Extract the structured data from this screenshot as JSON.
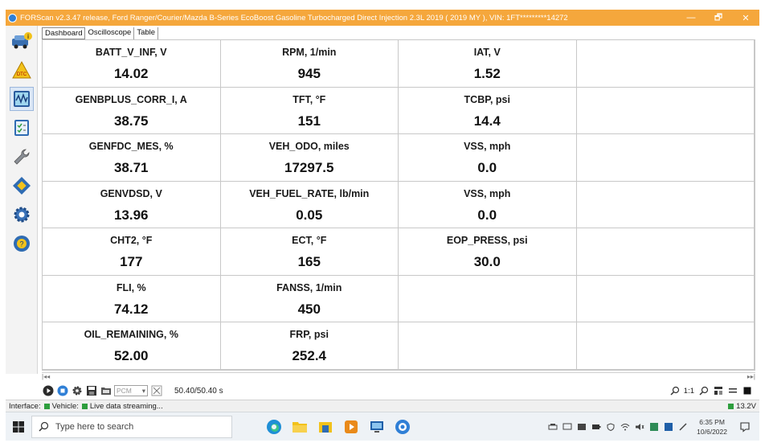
{
  "window": {
    "title": "FORScan v2.3.47 release, Ford Ranger/Courier/Mazda B-Series EcoBoost Gasoline Turbocharged Direct Injection 2.3L 2019 ( 2019 MY ), VIN: 1FT*********14272",
    "minimize": "—",
    "maximize": "🗗",
    "close": "✕"
  },
  "sidebar": {
    "items": [
      {
        "icon": "vehicle-info-icon"
      },
      {
        "icon": "dtc-icon"
      },
      {
        "icon": "oscilloscope-icon",
        "active": true
      },
      {
        "icon": "checklist-icon"
      },
      {
        "icon": "wrench-icon"
      },
      {
        "icon": "chip-icon"
      },
      {
        "icon": "gear-icon"
      },
      {
        "icon": "help-icon"
      }
    ]
  },
  "tabs": [
    {
      "label": "Dashboard",
      "active": true
    },
    {
      "label": "Oscilloscope"
    },
    {
      "label": "Table"
    }
  ],
  "dashboard": {
    "cells": [
      {
        "label": "BATT_V_INF, V",
        "value": "14.02"
      },
      {
        "label": "RPM, 1/min",
        "value": "945"
      },
      {
        "label": "IAT, V",
        "value": "1.52"
      },
      {
        "label": "",
        "value": ""
      },
      {
        "label": "GENBPLUS_CORR_I, A",
        "value": "38.75"
      },
      {
        "label": "TFT, °F",
        "value": "151"
      },
      {
        "label": "TCBP, psi",
        "value": "14.4"
      },
      {
        "label": "",
        "value": ""
      },
      {
        "label": "GENFDC_MES, %",
        "value": "38.71"
      },
      {
        "label": "VEH_ODO, miles",
        "value": "17297.5"
      },
      {
        "label": "VSS, mph",
        "value": "0.0"
      },
      {
        "label": "",
        "value": ""
      },
      {
        "label": "GENVDSD, V",
        "value": "13.96"
      },
      {
        "label": "VEH_FUEL_RATE, lb/min",
        "value": "0.05"
      },
      {
        "label": "VSS, mph",
        "value": "0.0"
      },
      {
        "label": "",
        "value": ""
      },
      {
        "label": "CHT2, °F",
        "value": "177"
      },
      {
        "label": "ECT, °F",
        "value": "165"
      },
      {
        "label": "EOP_PRESS, psi",
        "value": "30.0"
      },
      {
        "label": "",
        "value": ""
      },
      {
        "label": "FLI, %",
        "value": "74.12"
      },
      {
        "label": "FANSS, 1/min",
        "value": "450"
      },
      {
        "label": "",
        "value": ""
      },
      {
        "label": "",
        "value": ""
      },
      {
        "label": "OIL_REMAINING, %",
        "value": "52.00"
      },
      {
        "label": "FRP, psi",
        "value": "252.4"
      },
      {
        "label": "",
        "value": ""
      },
      {
        "label": "",
        "value": ""
      }
    ]
  },
  "scroll": {
    "left": "|◂◂",
    "right": "▸▸|"
  },
  "toolbar": {
    "module_select": "PCM",
    "time": "50.40/50.40 s",
    "zoom": "1:1"
  },
  "status": {
    "interface_label": "Interface:",
    "vehicle_label": "Vehicle:",
    "message": "Live data streaming...",
    "voltage": "13.2V",
    "indicator_color": "#2e9e3e"
  },
  "taskbar": {
    "search_placeholder": "Type here to search",
    "time": "6:35 PM",
    "date": "10/6/2022"
  },
  "colors": {
    "titlebar": "#f5a73c",
    "accent": "#2f7fd6"
  }
}
